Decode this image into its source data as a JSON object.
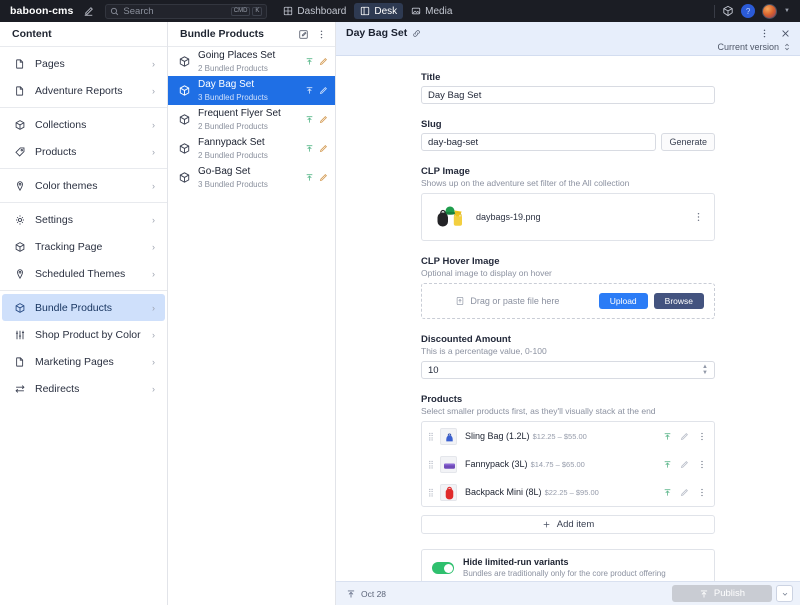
{
  "topbar": {
    "brand": "baboon-cms",
    "compose_icon": "compose-icon",
    "search": {
      "placeholder": "Search",
      "icon": "search-icon",
      "kbd1": "CMD",
      "kbd2": "K"
    },
    "tabs": [
      {
        "label": "Dashboard",
        "icon": "dashboard-icon",
        "active": false
      },
      {
        "label": "Desk",
        "icon": "desk-icon",
        "active": true
      },
      {
        "label": "Media",
        "icon": "media-icon",
        "active": false
      }
    ],
    "right": {
      "package_icon": "package-icon",
      "help_icon": "help-circle-icon",
      "avatar": "user-avatar",
      "caret": "chevron-down-icon"
    }
  },
  "sidebar": {
    "title": "Content",
    "items": [
      {
        "label": "Pages",
        "icon": "pages-icon",
        "selected": false
      },
      {
        "label": "Adventure Reports",
        "icon": "pages-icon",
        "selected": false
      },
      {
        "label": "Collections",
        "icon": "box-icon",
        "selected": false
      },
      {
        "label": "Products",
        "icon": "tag-icon",
        "selected": false
      },
      {
        "label": "Color themes",
        "icon": "pin-icon",
        "selected": false
      },
      {
        "label": "Settings",
        "icon": "gear-icon",
        "selected": false
      },
      {
        "label": "Tracking Page",
        "icon": "box-icon",
        "selected": false
      },
      {
        "label": "Scheduled Themes",
        "icon": "pin-icon",
        "selected": false
      },
      {
        "label": "Bundle Products",
        "icon": "box-icon",
        "selected": true
      },
      {
        "label": "Shop Product by Color",
        "icon": "sliders-icon",
        "selected": false
      },
      {
        "label": "Marketing Pages",
        "icon": "pages-icon",
        "selected": false
      },
      {
        "label": "Redirects",
        "icon": "redirect-icon",
        "selected": false
      }
    ],
    "separators_after": [
      1,
      3,
      4,
      7
    ]
  },
  "list_pane": {
    "title": "Bundle Products",
    "actions": {
      "create": "compose-icon",
      "menu": "more-vertical-icon"
    },
    "items": [
      {
        "title": "Going Places Set",
        "subtitle": "2 Bundled Products",
        "selected": false
      },
      {
        "title": "Day Bag Set",
        "subtitle": "3 Bundled Products",
        "selected": true
      },
      {
        "title": "Frequent Flyer Set",
        "subtitle": "2 Bundled Products",
        "selected": false
      },
      {
        "title": "Fannypack Set",
        "subtitle": "2 Bundled Products",
        "selected": false
      },
      {
        "title": "Go-Bag Set",
        "subtitle": "3 Bundled Products",
        "selected": false
      }
    ]
  },
  "document": {
    "title": "Day Bag Set",
    "link_icon": "link-icon",
    "menu_icon": "more-vertical-icon",
    "close_icon": "close-icon",
    "version_label": "Current version",
    "version_caret": "chevron-updown-icon",
    "fields": {
      "title": {
        "label": "Title",
        "value": "Day Bag Set"
      },
      "slug": {
        "label": "Slug",
        "value": "day-bag-set",
        "generate_label": "Generate"
      },
      "clp_image": {
        "label": "CLP Image",
        "description": "Shows up on the adventure set filter of the All collection",
        "filename": "daybags-19.png",
        "menu_icon": "more-vertical-icon"
      },
      "clp_hover_image": {
        "label": "CLP Hover Image",
        "description": "Optional image to display on hover",
        "dropzone_text": "Drag or paste file here",
        "dropzone_icon": "file-upload-icon",
        "upload_label": "Upload",
        "browse_label": "Browse"
      },
      "discounted_amount": {
        "label": "Discounted Amount",
        "description": "This is a percentage value, 0-100",
        "value": "10"
      },
      "products": {
        "label": "Products",
        "description": "Select smaller products first, as they'll visually stack at the end",
        "items": [
          {
            "title": "Sling Bag (1.2L)",
            "price": "$12.25 – $55.00",
            "color": "#3a5fd0"
          },
          {
            "title": "Fannypack (3L)",
            "price": "$14.75 – $65.00",
            "color": "#6f4ab8"
          },
          {
            "title": "Backpack Mini (8L)",
            "price": "$22.25 – $95.00",
            "color": "#e02b2b"
          }
        ],
        "add_item_label": "Add item"
      },
      "hide_variants": {
        "title": "Hide limited-run variants",
        "description": "Bundles are traditionally only for the core product offering",
        "enabled": true
      }
    },
    "footer": {
      "date": "Oct 28",
      "status_icon": "publish-icon",
      "publish_label": "Publish",
      "publish_icon": "publish-icon",
      "caret_icon": "chevron-down-icon"
    }
  },
  "colors": {
    "accent_blue": "#1f6fe5",
    "selected_nav": "#cfe0fb",
    "topbar_bg": "#1b1d24",
    "doc_header_bg": "#e7eefb",
    "toggle_green": "#2fc06e",
    "upload_blue": "#2b7cf6",
    "browse_navy": "#43537f"
  }
}
